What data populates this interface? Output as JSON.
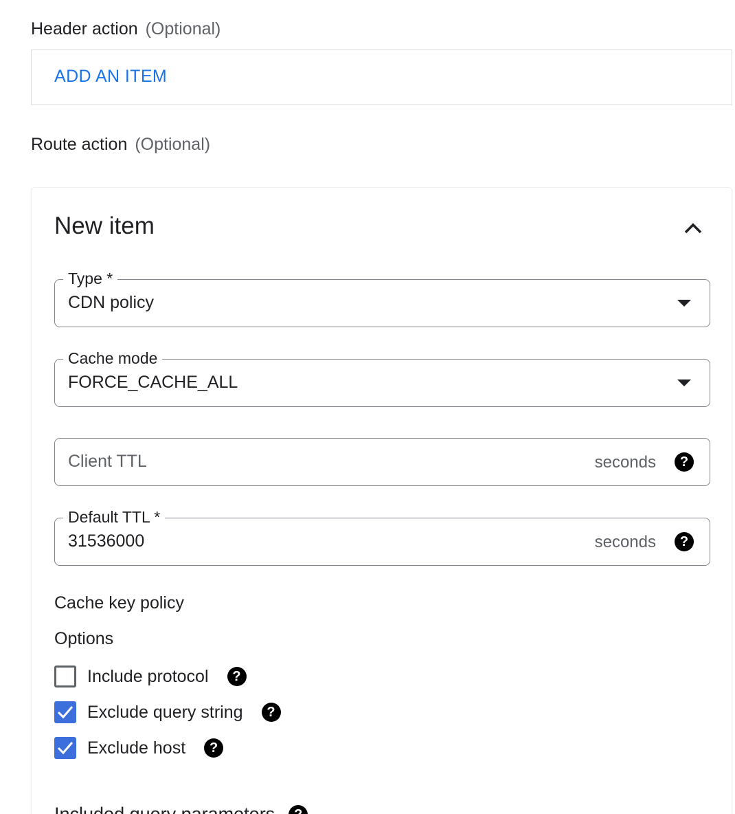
{
  "header_action": {
    "label": "Header action",
    "optional": "(Optional)",
    "add_button": "ADD AN ITEM"
  },
  "route_action": {
    "label": "Route action",
    "optional": "(Optional)"
  },
  "item": {
    "title": "New item",
    "type_field": {
      "label": "Type *",
      "value": "CDN policy"
    },
    "cache_mode_field": {
      "label": "Cache mode",
      "value": "FORCE_CACHE_ALL"
    },
    "client_ttl_field": {
      "placeholder": "Client TTL",
      "suffix": "seconds"
    },
    "default_ttl_field": {
      "label": "Default TTL *",
      "value": "31536000",
      "suffix": "seconds"
    },
    "cache_key_policy": {
      "heading": "Cache key policy",
      "options_heading": "Options",
      "options": [
        {
          "label": "Include protocol",
          "checked": false
        },
        {
          "label": "Exclude query string",
          "checked": true
        },
        {
          "label": "Exclude host",
          "checked": true
        }
      ]
    },
    "included_query_params": {
      "label": "Included query parameters"
    }
  },
  "colors": {
    "accent": "#1a73e8",
    "checkbox_checked": "#3c6fdc",
    "outline": "#80868b"
  }
}
